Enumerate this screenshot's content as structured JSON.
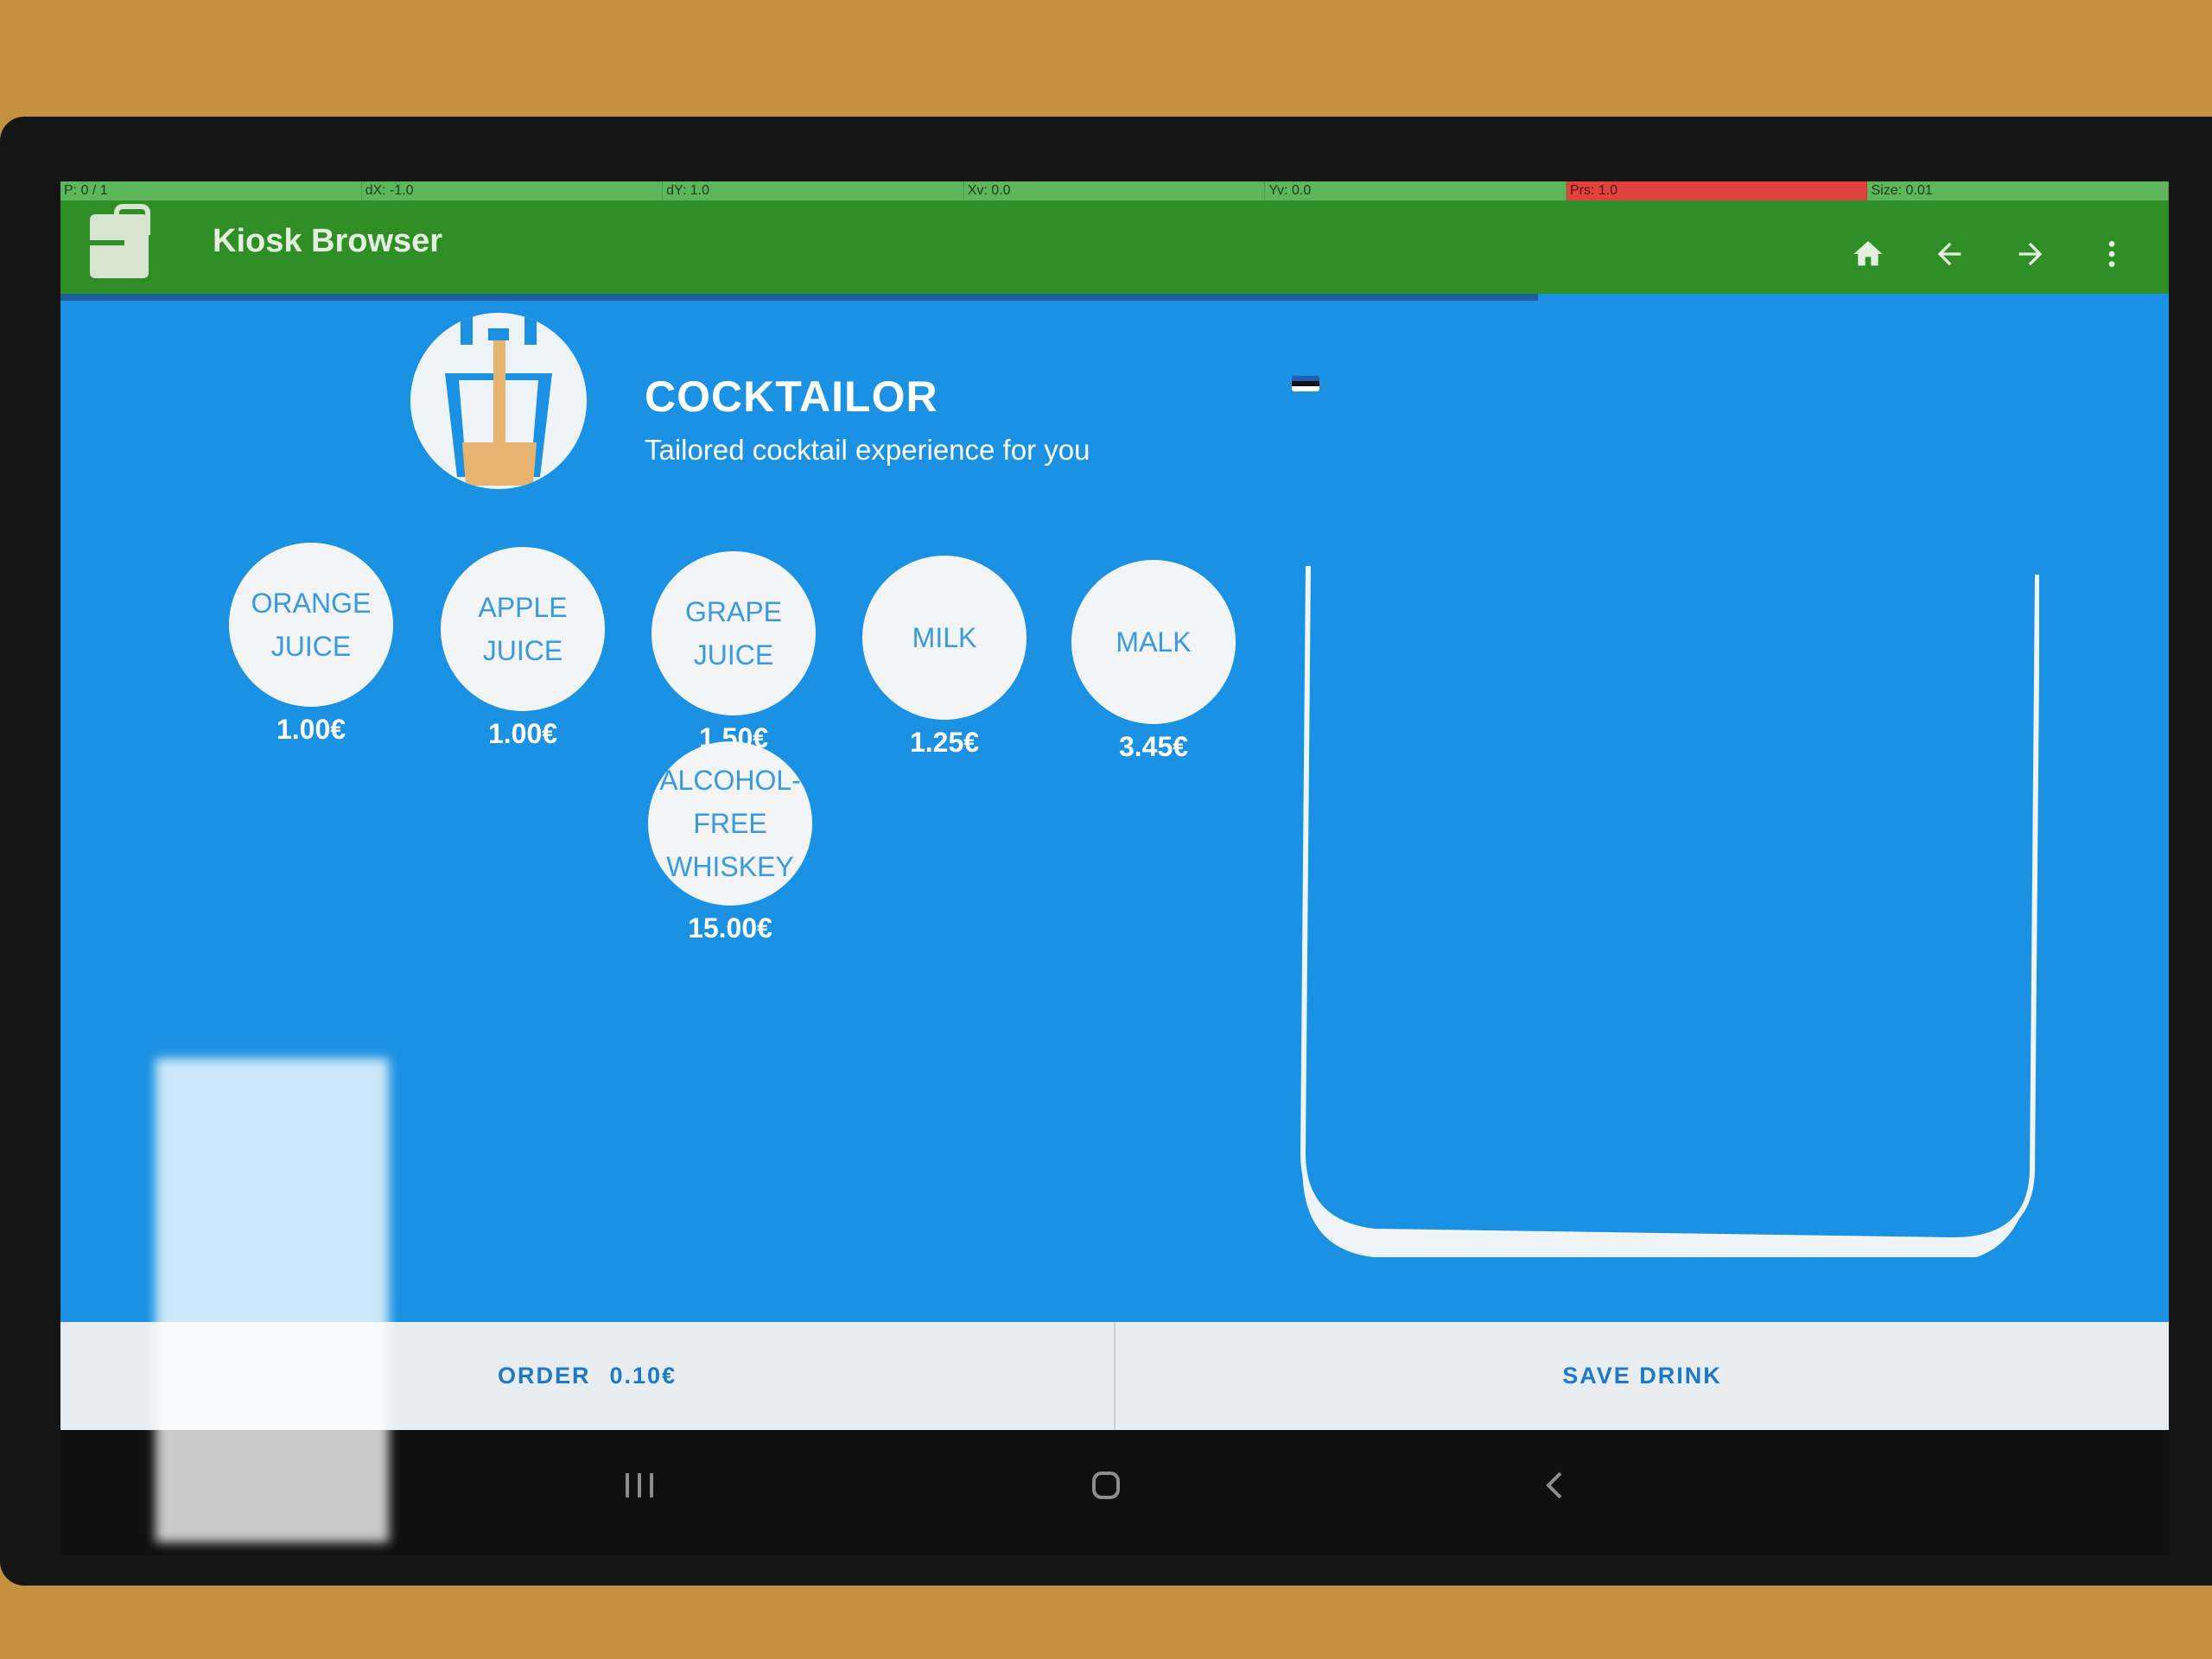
{
  "debug": {
    "cells": [
      {
        "label": "P: 0 / 1"
      },
      {
        "label": "dX: -1.0"
      },
      {
        "label": "dY: 1.0"
      },
      {
        "label": "Xv: 0.0"
      },
      {
        "label": "Yv: 0.0"
      },
      {
        "label": "Prs: 1.0"
      },
      {
        "label": "Size: 0.01"
      }
    ]
  },
  "appbar": {
    "title": "Kiosk Browser",
    "icons": [
      "home-icon",
      "arrow-left-icon",
      "arrow-right-icon",
      "more-vert-icon"
    ]
  },
  "brand": {
    "title": "COCKTAILOR",
    "subtitle": "Tailored cocktail experience for you"
  },
  "ingredients": [
    {
      "name": "ORANGE JUICE",
      "price": "1.00€"
    },
    {
      "name": "APPLE JUICE",
      "price": "1.00€"
    },
    {
      "name": "GRAPE JUICE",
      "price": "1.50€"
    },
    {
      "name": "MILK",
      "price": "1.25€"
    },
    {
      "name": "MALK",
      "price": "3.45€"
    },
    {
      "name": "ALCOHOL-FREE WHISKEY",
      "price": "15.00€"
    }
  ],
  "bottom": {
    "order_label": "ORDER",
    "order_price": "0.10€",
    "save_label": "SAVE DRINK"
  },
  "colors": {
    "appbar": "#2f8f26",
    "background": "#1a91e2",
    "bubble": "#f3f4f6",
    "bubble_text": "#3a9ae0",
    "button_text": "#1f78c8"
  }
}
